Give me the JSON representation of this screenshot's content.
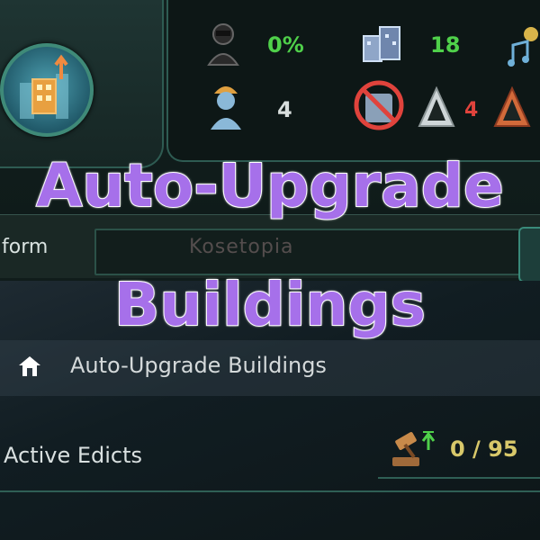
{
  "overlay_title": {
    "line1": "Auto-Upgrade",
    "line2": "Buildings"
  },
  "resources": {
    "unemployment": {
      "icon": "person-silhouette-icon",
      "value": "0%"
    },
    "housing": {
      "icon": "housing-blocks-icon",
      "value": "18"
    },
    "amenities": {
      "icon": "music-note-icon"
    },
    "workers": {
      "icon": "worker-helmet-icon",
      "value": "4"
    },
    "crime": {
      "icon": "no-crime-icon"
    },
    "strata_1": {
      "icon": "pyramid-icon"
    },
    "strata_2": {
      "icon": "pyramid-red-icon",
      "value": "4"
    }
  },
  "planet": {
    "name": "Kosetopia",
    "section_label": "form"
  },
  "list": {
    "auto_upgrade_label": "Auto-Upgrade Buildings"
  },
  "edicts": {
    "label": "Active Edicts",
    "count": "0 / 95"
  },
  "colors": {
    "accent": "#a670ea",
    "panel_border": "#2e5b52",
    "green": "#4fd04a",
    "gold": "#d8c86a"
  }
}
